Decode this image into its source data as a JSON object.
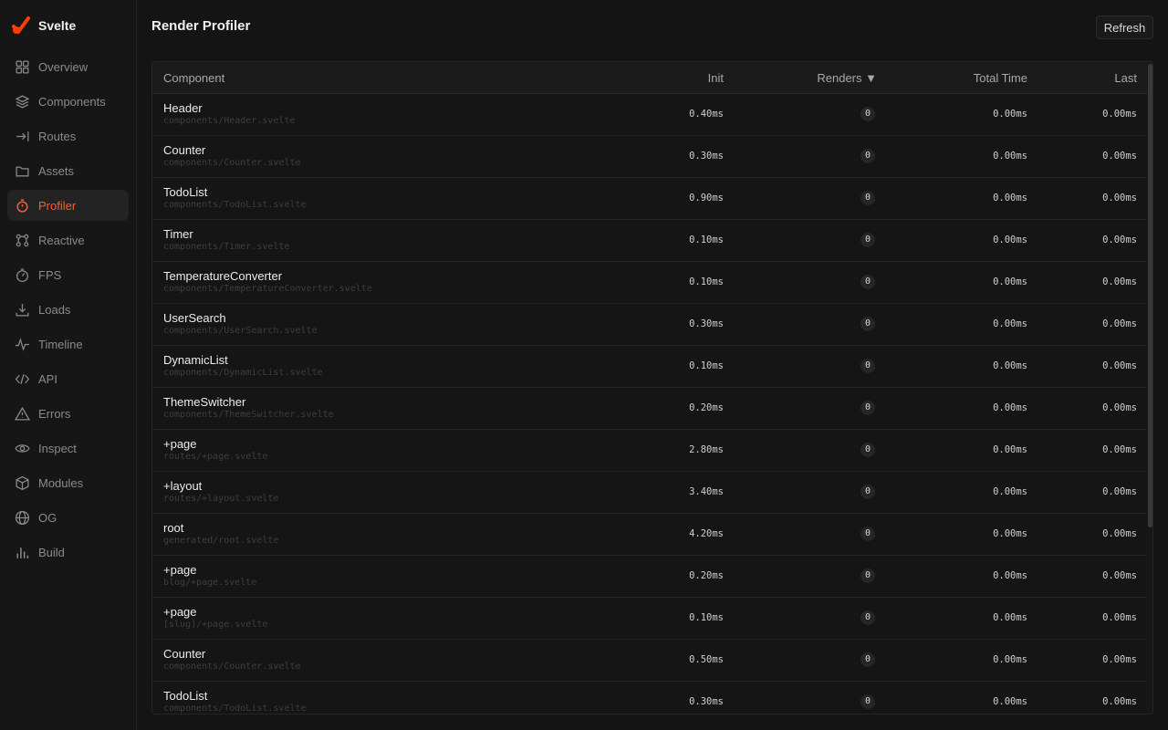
{
  "brand": {
    "name": "Svelte",
    "accent": "#ff3e00"
  },
  "sidebar": {
    "items": [
      {
        "label": "Overview",
        "icon": "grid-icon",
        "active": false
      },
      {
        "label": "Components",
        "icon": "layers-icon",
        "active": false
      },
      {
        "label": "Routes",
        "icon": "route-arrow-icon",
        "active": false
      },
      {
        "label": "Assets",
        "icon": "folder-icon",
        "active": false
      },
      {
        "label": "Profiler",
        "icon": "stopwatch-icon",
        "active": true
      },
      {
        "label": "Reactive",
        "icon": "graph-nodes-icon",
        "active": false
      },
      {
        "label": "FPS",
        "icon": "gauge-icon",
        "active": false
      },
      {
        "label": "Loads",
        "icon": "download-icon",
        "active": false
      },
      {
        "label": "Timeline",
        "icon": "pulse-icon",
        "active": false
      },
      {
        "label": "API",
        "icon": "code-icon",
        "active": false
      },
      {
        "label": "Errors",
        "icon": "warning-icon",
        "active": false
      },
      {
        "label": "Inspect",
        "icon": "eye-icon",
        "active": false
      },
      {
        "label": "Modules",
        "icon": "cube-icon",
        "active": false
      },
      {
        "label": "OG",
        "icon": "globe-icon",
        "active": false
      },
      {
        "label": "Build",
        "icon": "bar-chart-icon",
        "active": false
      }
    ]
  },
  "header": {
    "title": "Render Profiler",
    "refresh_label": "Refresh"
  },
  "table": {
    "columns": {
      "component": "Component",
      "init": "Init",
      "renders": "Renders ▼",
      "total": "Total Time",
      "last": "Last"
    },
    "rows": [
      {
        "name": "Header",
        "path": "components/Header.svelte",
        "init": "0.40ms",
        "renders": "0",
        "total": "0.00ms",
        "last": "0.00ms"
      },
      {
        "name": "Counter",
        "path": "components/Counter.svelte",
        "init": "0.30ms",
        "renders": "0",
        "total": "0.00ms",
        "last": "0.00ms"
      },
      {
        "name": "TodoList",
        "path": "components/TodoList.svelte",
        "init": "0.90ms",
        "renders": "0",
        "total": "0.00ms",
        "last": "0.00ms"
      },
      {
        "name": "Timer",
        "path": "components/Timer.svelte",
        "init": "0.10ms",
        "renders": "0",
        "total": "0.00ms",
        "last": "0.00ms"
      },
      {
        "name": "TemperatureConverter",
        "path": "components/TemperatureConverter.svelte",
        "init": "0.10ms",
        "renders": "0",
        "total": "0.00ms",
        "last": "0.00ms"
      },
      {
        "name": "UserSearch",
        "path": "components/UserSearch.svelte",
        "init": "0.30ms",
        "renders": "0",
        "total": "0.00ms",
        "last": "0.00ms"
      },
      {
        "name": "DynamicList",
        "path": "components/DynamicList.svelte",
        "init": "0.10ms",
        "renders": "0",
        "total": "0.00ms",
        "last": "0.00ms"
      },
      {
        "name": "ThemeSwitcher",
        "path": "components/ThemeSwitcher.svelte",
        "init": "0.20ms",
        "renders": "0",
        "total": "0.00ms",
        "last": "0.00ms"
      },
      {
        "name": "+page",
        "path": "routes/+page.svelte",
        "init": "2.80ms",
        "renders": "0",
        "total": "0.00ms",
        "last": "0.00ms"
      },
      {
        "name": "+layout",
        "path": "routes/+layout.svelte",
        "init": "3.40ms",
        "renders": "0",
        "total": "0.00ms",
        "last": "0.00ms"
      },
      {
        "name": "root",
        "path": "generated/root.svelte",
        "init": "4.20ms",
        "renders": "0",
        "total": "0.00ms",
        "last": "0.00ms"
      },
      {
        "name": "+page",
        "path": "blog/+page.svelte",
        "init": "0.20ms",
        "renders": "0",
        "total": "0.00ms",
        "last": "0.00ms"
      },
      {
        "name": "+page",
        "path": "[slug]/+page.svelte",
        "init": "0.10ms",
        "renders": "0",
        "total": "0.00ms",
        "last": "0.00ms"
      },
      {
        "name": "Counter",
        "path": "components/Counter.svelte",
        "init": "0.50ms",
        "renders": "0",
        "total": "0.00ms",
        "last": "0.00ms"
      },
      {
        "name": "TodoList",
        "path": "components/TodoList.svelte",
        "init": "0.30ms",
        "renders": "0",
        "total": "0.00ms",
        "last": "0.00ms"
      }
    ]
  }
}
